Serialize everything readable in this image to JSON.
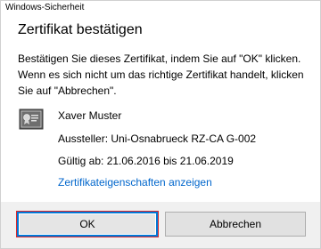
{
  "window": {
    "title": "Windows-Sicherheit"
  },
  "dialog": {
    "heading": "Zertifikat bestätigen",
    "message": "Bestätigen Sie dieses Zertifikat, indem Sie auf \"OK\" klicken. Wenn es sich nicht um das richtige Zertifikat handelt, klicken Sie auf \"Abbrechen\"."
  },
  "certificate": {
    "icon": "certificate-icon",
    "name": "Xaver Muster",
    "issuer": "Aussteller: Uni-Osnabrueck RZ-CA G-002",
    "validity": "Gültig ab: 21.06.2016 bis 21.06.2019",
    "properties_link": "Zertifikateigenschaften anzeigen"
  },
  "buttons": {
    "ok": "OK",
    "cancel": "Abbrechen"
  },
  "colors": {
    "link": "#0066cc",
    "focus_ring": "#0078d7",
    "highlight_annotation": "#d9262b",
    "button_bar": "#f0f0f0"
  }
}
